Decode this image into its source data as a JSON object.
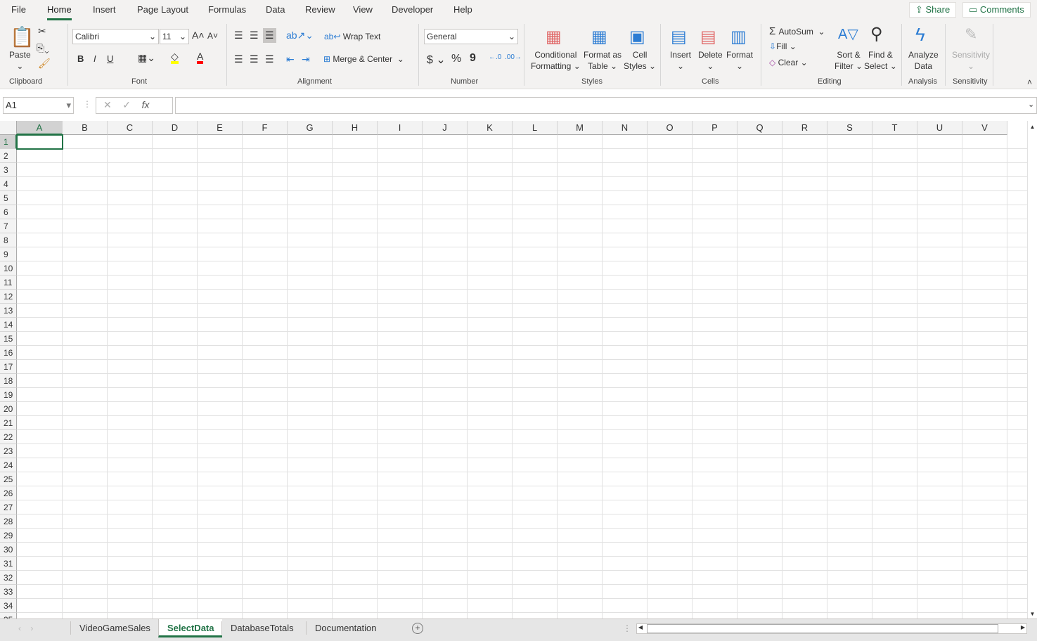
{
  "menu_tabs": [
    "File",
    "Home",
    "Insert",
    "Page Layout",
    "Formulas",
    "Data",
    "Review",
    "View",
    "Developer",
    "Help"
  ],
  "active_tab": "Home",
  "share": "Share",
  "comments": "Comments",
  "clipboard": {
    "paste": "Paste",
    "group": "Clipboard"
  },
  "font": {
    "name": "Calibri",
    "size": "11",
    "group": "Font",
    "bold": "B",
    "italic": "I",
    "underline": "U",
    "fill_color": "#ffff00",
    "font_color": "#ff0000"
  },
  "alignment": {
    "wrap": "Wrap Text",
    "merge": "Merge & Center",
    "group": "Alignment"
  },
  "number": {
    "format": "General",
    "currency": "$",
    "percent": "%",
    "comma": "9",
    "group": "Number"
  },
  "styles": {
    "conditional": [
      "Conditional",
      "Formatting"
    ],
    "format_table": [
      "Format as",
      "Table"
    ],
    "cell_styles": [
      "Cell",
      "Styles"
    ],
    "group": "Styles"
  },
  "cells": {
    "insert": "Insert",
    "delete": "Delete",
    "format": "Format",
    "group": "Cells"
  },
  "editing": {
    "autosum": "AutoSum",
    "fill": "Fill",
    "clear": "Clear",
    "sort": [
      "Sort &",
      "Filter"
    ],
    "find": [
      "Find &",
      "Select"
    ],
    "group": "Editing"
  },
  "analysis": {
    "analyze": [
      "Analyze",
      "Data"
    ],
    "group": "Analysis"
  },
  "sensitivity": {
    "label": "Sensitivity",
    "group": "Sensitivity"
  },
  "name_box": "A1",
  "fx": "fx",
  "formula": "",
  "columns": [
    "A",
    "B",
    "C",
    "D",
    "E",
    "F",
    "G",
    "H",
    "I",
    "J",
    "K",
    "L",
    "M",
    "N",
    "O",
    "P",
    "Q",
    "R",
    "S",
    "T",
    "U",
    "V"
  ],
  "row_count": 35,
  "selected_cell": "A1",
  "sheets": [
    "VideoGameSales",
    "SelectData",
    "DatabaseTotals",
    "Documentation"
  ],
  "active_sheet": "SelectData",
  "accent": "#217346"
}
